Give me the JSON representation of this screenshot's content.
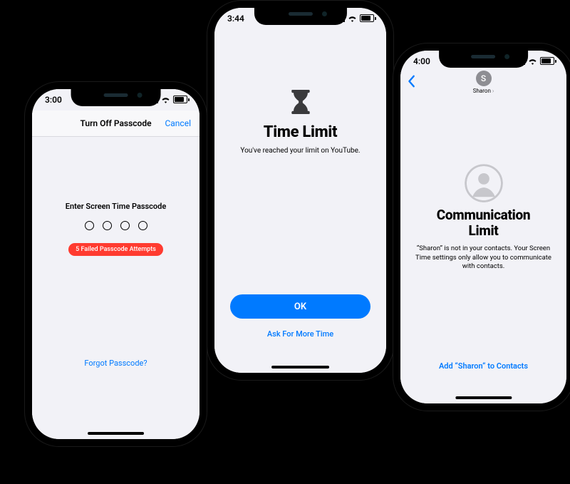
{
  "phone1": {
    "time": "3:00",
    "header_title": "Turn Off Passcode",
    "cancel": "Cancel",
    "prompt": "Enter Screen Time Passcode",
    "error_pill": "5 Failed Passcode Attempts",
    "forgot": "Forgot Passcode?"
  },
  "phone2": {
    "time": "3:44",
    "icon_name": "hourglass-icon",
    "title": "Time Limit",
    "message": "You've reached your limit on YouTube.",
    "ok": "OK",
    "ask": "Ask For More Time"
  },
  "phone3": {
    "time": "4:00",
    "contact_initial": "S",
    "contact_name": "Sharon",
    "icon_name": "person-circle-icon",
    "title_line1": "Communication",
    "title_line2": "Limit",
    "message": "“Sharon” is not in your contacts. Your Screen Time settings only allow you to communicate with contacts.",
    "add_button": "Add “Sharon” to Contacts"
  },
  "colors": {
    "ios_blue": "#007aff",
    "ios_red": "#ff3b30"
  }
}
